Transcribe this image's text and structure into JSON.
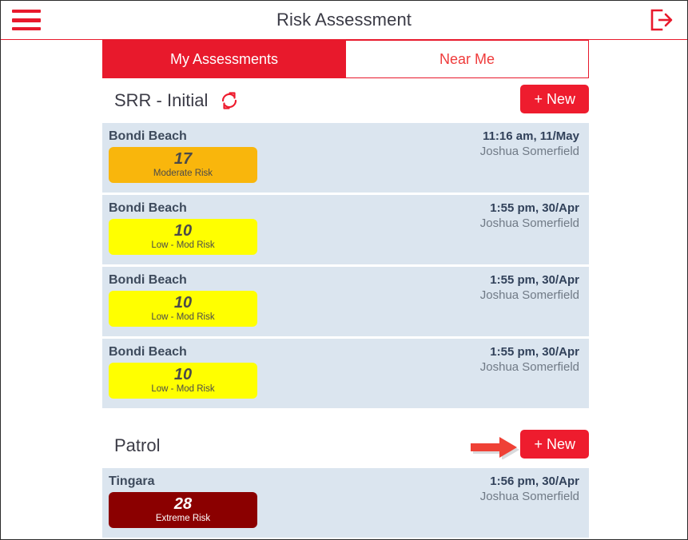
{
  "header": {
    "title": "Risk Assessment",
    "menu_icon": "hamburger-menu-icon",
    "logout_icon": "logout-icon"
  },
  "tabs": [
    {
      "label": "My Assessments",
      "active": true
    },
    {
      "label": "Near Me",
      "active": false
    }
  ],
  "sections": [
    {
      "title": "SRR - Initial",
      "refresh_icon": "refresh-icon",
      "new_label": "New",
      "new_plus": "+",
      "has_annotation_arrow": false,
      "cards": [
        {
          "title": "Bondi Beach",
          "score": "17",
          "risk_label": "Moderate Risk",
          "risk_level": "moderate",
          "time": "11:16 am, 11/May",
          "user": "Joshua Somerfield"
        },
        {
          "title": "Bondi Beach",
          "score": "10",
          "risk_label": "Low - Mod Risk",
          "risk_level": "lowmod",
          "time": "1:55 pm, 30/Apr",
          "user": "Joshua Somerfield"
        },
        {
          "title": "Bondi Beach",
          "score": "10",
          "risk_label": "Low - Mod Risk",
          "risk_level": "lowmod",
          "time": "1:55 pm, 30/Apr",
          "user": "Joshua Somerfield"
        },
        {
          "title": "Bondi Beach",
          "score": "10",
          "risk_label": "Low - Mod Risk",
          "risk_level": "lowmod",
          "time": "1:55 pm, 30/Apr",
          "user": "Joshua Somerfield"
        }
      ]
    },
    {
      "title": "Patrol",
      "refresh_icon": null,
      "new_label": "New",
      "new_plus": "+",
      "has_annotation_arrow": true,
      "cards": [
        {
          "title": "Tingara",
          "score": "28",
          "risk_label": "Extreme Risk",
          "risk_level": "extreme",
          "time": "1:56 pm, 30/Apr",
          "user": "Joshua Somerfield"
        }
      ]
    }
  ],
  "colors": {
    "brand_red": "#e8192c",
    "button_red": "#ee1c2e",
    "card_bg": "#dbe5ef",
    "moderate": "#f9b60c",
    "lowmod": "#ffff00",
    "extreme": "#8b0000",
    "annotation_arrow": "#ef4136"
  }
}
